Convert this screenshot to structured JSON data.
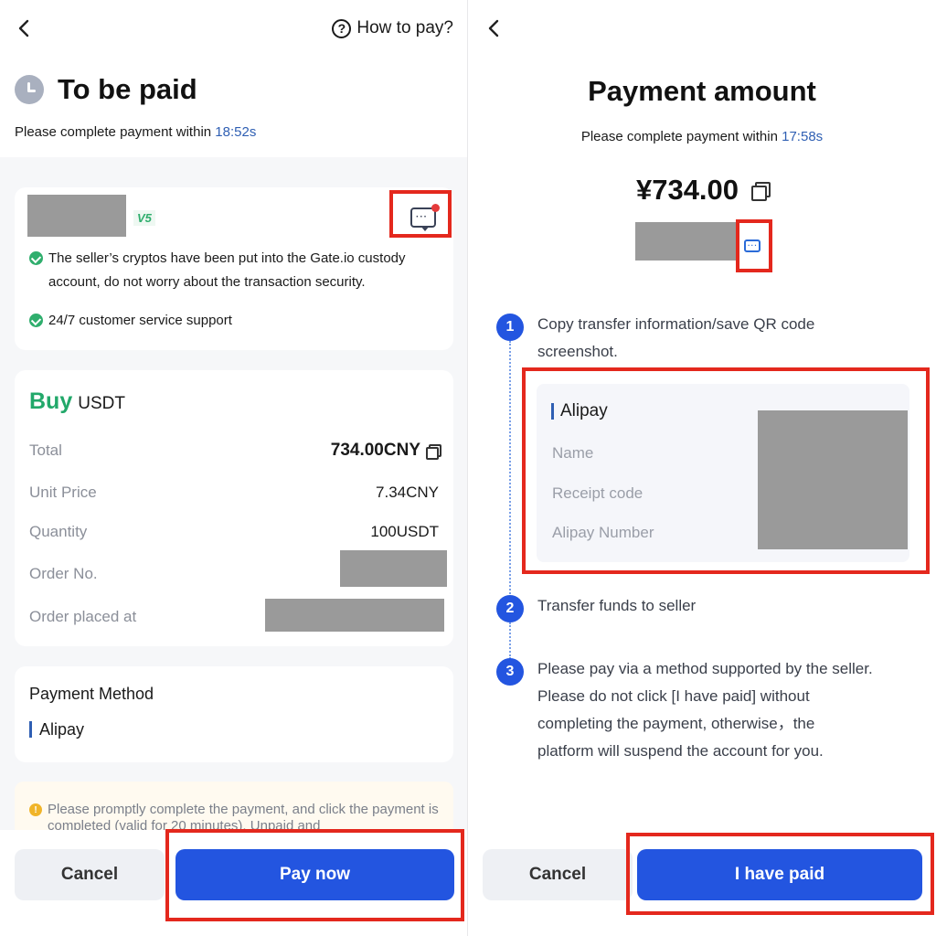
{
  "left": {
    "header": {
      "how_to_pay": "How to pay?"
    },
    "title": "To be paid",
    "timer_text": "Please complete payment within",
    "timer_value": "18:52s",
    "seller": {
      "badge": "V5",
      "bullets": [
        "The seller’s cryptos have been put into the Gate.io custody account, do not worry about the transaction security.",
        "24/7 customer service support"
      ]
    },
    "order": {
      "action": "Buy",
      "asset": "USDT",
      "rows": [
        {
          "label": "Total",
          "value": "734.00CNY"
        },
        {
          "label": "Unit Price",
          "value": "7.34CNY"
        },
        {
          "label": "Quantity",
          "value": "100USDT"
        },
        {
          "label": "Order No.",
          "value": ""
        },
        {
          "label": "Order placed at",
          "value": ""
        }
      ]
    },
    "payment_method": {
      "title": "Payment Method",
      "method": "Alipay"
    },
    "notice": "Please promptly complete the payment, and click the payment is completed (valid for 20 minutes). Unpaid and",
    "buttons": {
      "cancel": "Cancel",
      "primary": "Pay now"
    }
  },
  "right": {
    "title": "Payment amount",
    "timer_text": "Please complete payment within",
    "timer_value": "17:58s",
    "amount": "¥734.00",
    "steps": [
      {
        "num": "1",
        "text_line1": "Copy transfer information/save QR code",
        "text_line2": "screenshot."
      },
      {
        "num": "2",
        "text_line1": "Transfer funds to seller"
      },
      {
        "num": "3",
        "lines": [
          "Please pay via a method supported by the seller.",
          "Please do not click [I have paid] without",
          "completing the payment, otherwise，the",
          "platform will suspend the account for you."
        ]
      }
    ],
    "alipay": {
      "title": "Alipay",
      "fields": [
        "Name",
        "Receipt code",
        "Alipay Number"
      ]
    },
    "buttons": {
      "cancel": "Cancel",
      "primary": "I have paid"
    }
  },
  "colors": {
    "primary": "#2355e0",
    "buy_green": "#22a86a",
    "timer_blue": "#2f5fb3",
    "highlight_red": "#e4281d"
  },
  "icons": [
    "back-arrow-icon",
    "question-circle-icon",
    "clock-icon",
    "chat-icon",
    "check-circle-icon",
    "copy-icon",
    "info-icon"
  ]
}
